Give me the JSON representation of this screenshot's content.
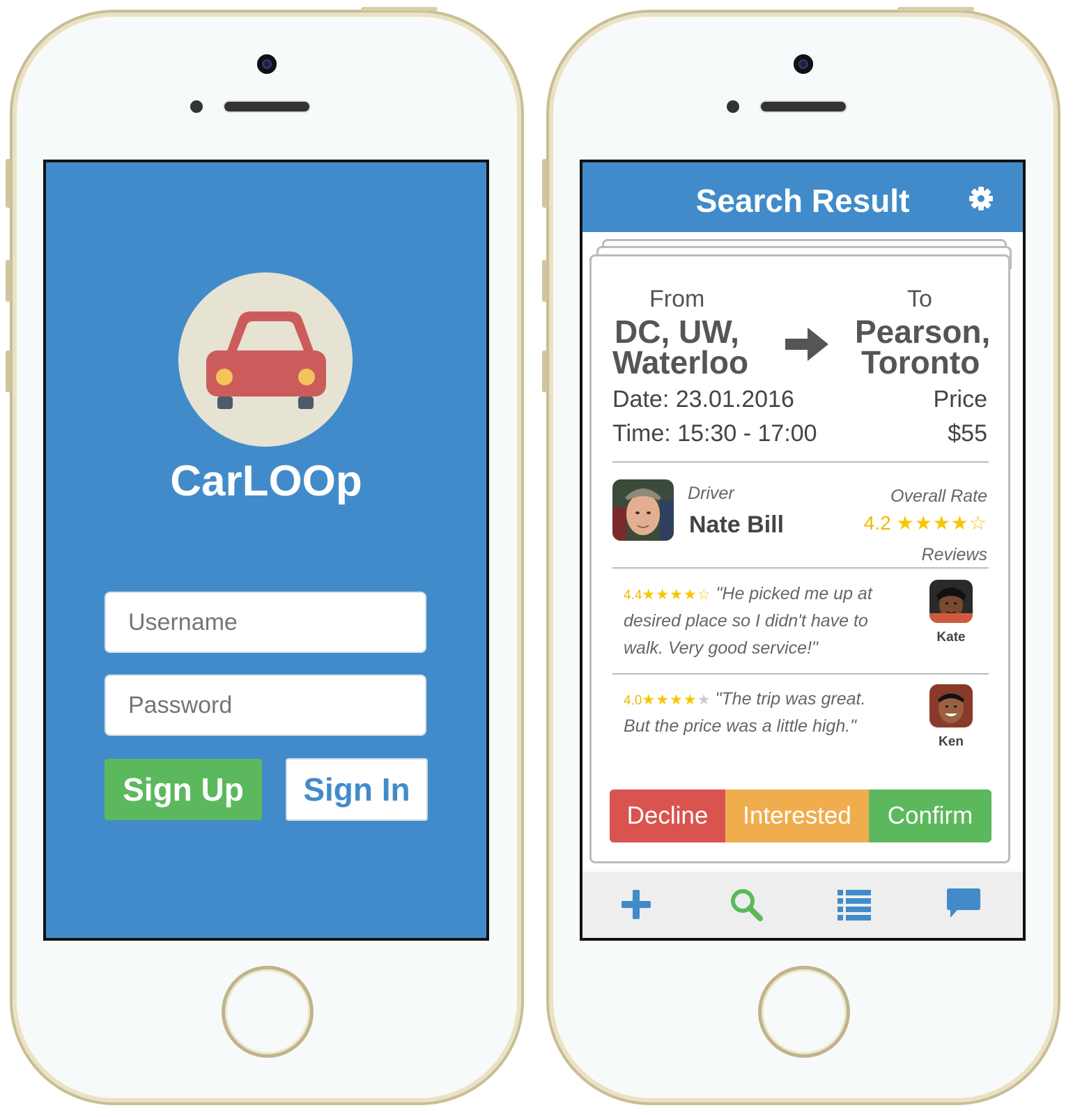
{
  "login": {
    "app_name": "CarLOOp",
    "logo_icon": "car-icon",
    "username_placeholder": "Username",
    "password_placeholder": "Password",
    "signup_label": "Sign Up",
    "signin_label": "Sign In",
    "colors": {
      "background": "#428bca",
      "signup": "#5cb85c",
      "signin_text": "#428bca"
    }
  },
  "search_result": {
    "title": "Search Result",
    "settings_icon": "gear-icon",
    "trip": {
      "from_label": "From",
      "from_line1": "DC, UW,",
      "from_line2": "Waterloo",
      "arrow_icon": "arrow-right-icon",
      "to_label": "To",
      "to_line1": "Pearson,",
      "to_line2": "Toronto",
      "date": "Date: 23.01.2016",
      "time": "Time: 15:30 - 17:00",
      "price_label": "Price",
      "price": "$55"
    },
    "driver": {
      "label": "Driver",
      "name": "Nate Bill",
      "overall_label": "Overall Rate",
      "rating": "4.2",
      "stars": "★★★★☆"
    },
    "reviews_label": "Reviews",
    "reviews": [
      {
        "rating": "4.4",
        "stars": "★★★★☆",
        "line1": "\"He picked me up at",
        "line2": "desired place so I didn't have to",
        "line3": "walk. Very good service!\"",
        "reviewer": "Kate"
      },
      {
        "rating": "4.0",
        "stars_full": "★★★★",
        "stars_empty": "★",
        "line1": "\"The trip was great.",
        "line2": "But the price was a little high.\"",
        "reviewer": "Ken"
      }
    ],
    "actions": {
      "decline": "Decline",
      "interested": "Interested",
      "confirm": "Confirm"
    },
    "action_colors": {
      "decline": "#d9534f",
      "interested": "#f0ad4e",
      "confirm": "#5cb85c"
    },
    "tabs": [
      "plus-icon",
      "search-icon",
      "list-icon",
      "chat-icon"
    ]
  }
}
